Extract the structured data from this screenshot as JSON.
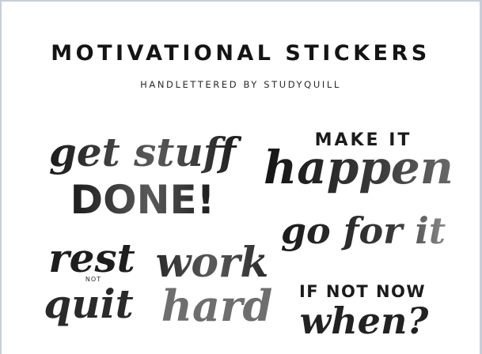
{
  "sheet": {
    "title": "MOTIVATIONAL STICKERS",
    "subtitle": "HANDLETTERED BY STUDYQUILL"
  },
  "stickers": {
    "get_stuff_done": {
      "line1": "get stuff",
      "line2": "DONE!"
    },
    "make_it_happen": {
      "line1": "MAKE IT",
      "line2": "happen"
    },
    "go_for_it": {
      "line1": "go for it"
    },
    "rest_not_quit": {
      "line1": "rest",
      "small": "NOT",
      "line2": "quit"
    },
    "work_hard": {
      "line1": "work",
      "line2": "hard"
    },
    "if_not_now_when": {
      "line1": "IF NOT NOW",
      "line2": "when?"
    }
  },
  "colors": {
    "ink": "#1b1b1b",
    "ink_mid": "#4a4a4a",
    "ink_light": "#8a8a8a",
    "paper": "#ffffff",
    "frame": "#c9cdd9"
  }
}
